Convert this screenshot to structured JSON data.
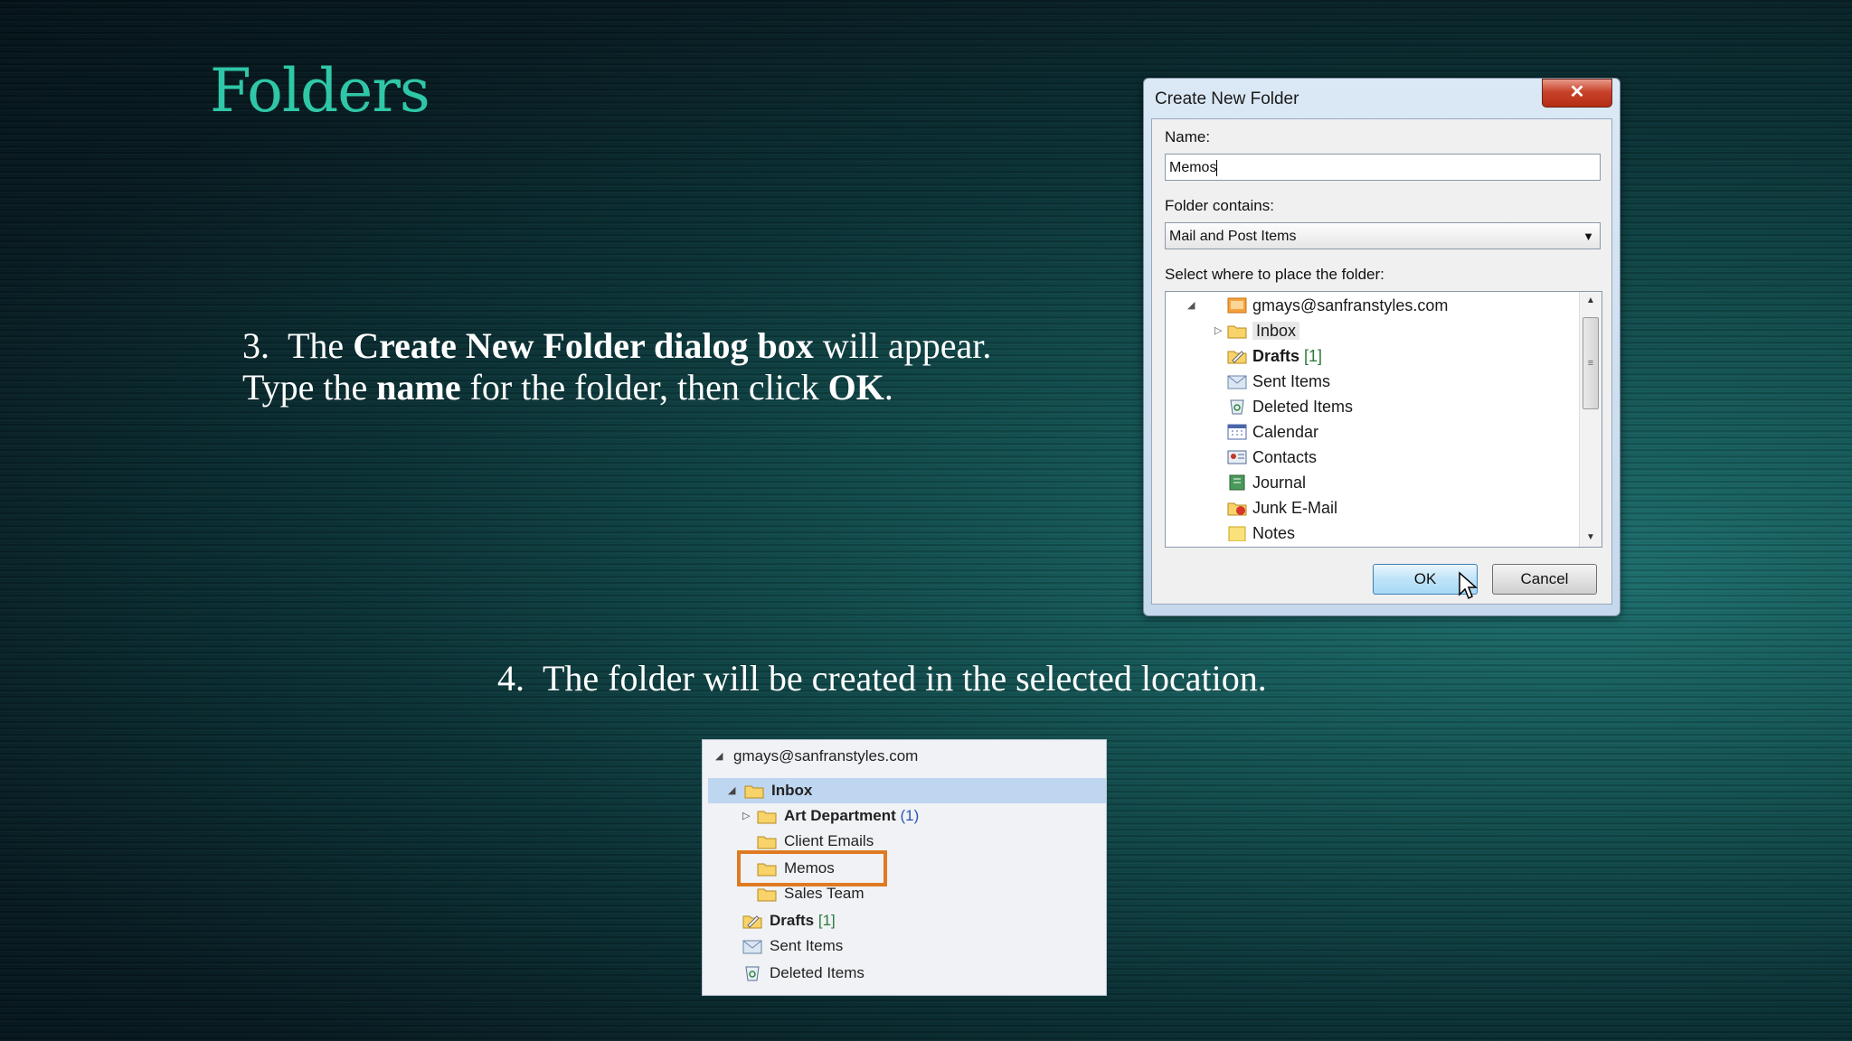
{
  "slide": {
    "title": "Folders",
    "step3": {
      "num": "3.",
      "text_pre": "The ",
      "bold1": "Create New Folder dialog box",
      "text_mid": " will appear.",
      "line2_pre": "Type the ",
      "bold2": "name",
      "line2_mid": " for the folder, then click ",
      "bold3": "OK",
      "line2_end": "."
    },
    "step4": {
      "num": "4.",
      "text": "The folder will be created in the selected location."
    }
  },
  "dialog": {
    "title": "Create New Folder",
    "close_label": "✕",
    "name_label": "Name:",
    "name_value": "Memos",
    "contains_label": "Folder contains:",
    "contains_value": "Mail and Post Items",
    "place_label": "Select where to place the folder:",
    "tree": {
      "account": "gmays@sanfranstyles.com",
      "items": [
        {
          "label": "Inbox",
          "icon": "inbox-icon"
        },
        {
          "label": "Drafts",
          "count": "[1]",
          "icon": "drafts-icon"
        },
        {
          "label": "Sent Items",
          "icon": "sent-items-icon"
        },
        {
          "label": "Deleted Items",
          "icon": "deleted-items-icon"
        },
        {
          "label": "Calendar",
          "icon": "calendar-icon"
        },
        {
          "label": "Contacts",
          "icon": "contacts-icon"
        },
        {
          "label": "Journal",
          "icon": "journal-icon"
        },
        {
          "label": "Junk E-Mail",
          "icon": "junk-mail-icon"
        },
        {
          "label": "Notes",
          "icon": "notes-icon"
        }
      ]
    },
    "ok_label": "OK",
    "cancel_label": "Cancel"
  },
  "folder_pane": {
    "account": "gmays@sanfranstyles.com",
    "inbox": "Inbox",
    "sub": [
      {
        "label": "Art Department",
        "count": "(1)"
      },
      {
        "label": "Client Emails"
      },
      {
        "label": "Memos"
      },
      {
        "label": "Sales Team"
      }
    ],
    "drafts": "Drafts",
    "drafts_count": "[1]",
    "sent": "Sent Items",
    "deleted": "Deleted Items"
  },
  "colors": {
    "title": "#2fc7a7",
    "highlight": "#e07a22",
    "selected_row": "#bfd6f0"
  }
}
